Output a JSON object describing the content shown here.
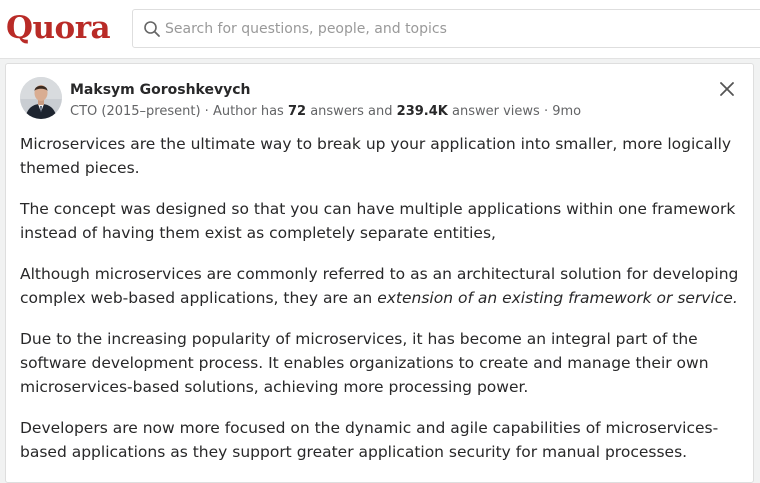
{
  "header": {
    "logo_text": "Quora",
    "search": {
      "placeholder": "Search for questions, people, and topics",
      "icon": "search-icon"
    }
  },
  "answer": {
    "author": {
      "name": "Maksym Goroshkevych",
      "credential": "CTO (2015–present)",
      "answers_prefix": "Author has",
      "answers_count": "72",
      "answers_label": "answers and",
      "views_count": "239.4K",
      "views_label": "answer views",
      "age": "9mo"
    },
    "close_icon": "close-icon",
    "paragraphs": [
      "Microservices are the ultimate way to break up your application into smaller, more logically themed pieces.",
      "The concept was designed so that you can have multiple applications within one framework instead of having them exist as completely separate entities,",
      "Although microservices are commonly referred to as an architectural solution for developing complex web-based applications, they are an",
      "Due to the increasing popularity of microservices, it has become an integral part of the software development process. It enables organizations to create and manage their own microservices-based solutions, achieving more processing power.",
      "Developers are now more focused on the dynamic and agile capabilities of microservices-based applications as they support greater application security for manual processes."
    ],
    "paragraph3_italic": "extension of an existing framework or service."
  },
  "colors": {
    "brand": "#b92b27",
    "text": "#282829",
    "meta": "#636466"
  }
}
